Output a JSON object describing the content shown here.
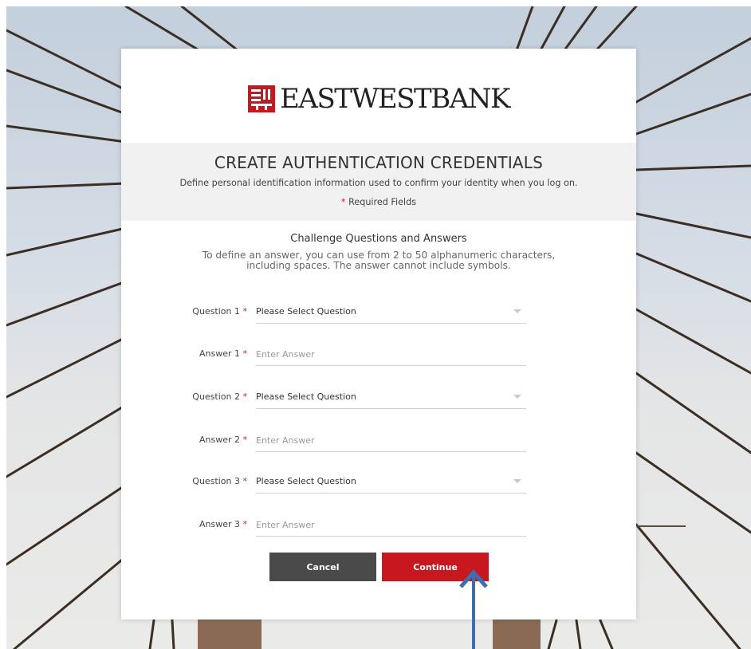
{
  "brand": {
    "name": "EASTWESTBANK",
    "accent": "#c8181f"
  },
  "header": {
    "title": "CREATE AUTHENTICATION CREDENTIALS",
    "subtitle": "Define personal identification information used to confirm your identity when you log on.",
    "required_star": "*",
    "required_text": "Required Fields"
  },
  "section": {
    "title": "Challenge Questions and Answers",
    "instructions": "To define an answer, you can use from 2 to 50 alphanumeric characters, including spaces. The answer cannot include symbols."
  },
  "fields": [
    {
      "label": "Question 1",
      "star": "*",
      "kind": "select",
      "value": "Please Select Question"
    },
    {
      "label": "Answer 1",
      "star": "*",
      "kind": "input",
      "placeholder": "Enter Answer"
    },
    {
      "label": "Question 2",
      "star": "*",
      "kind": "select",
      "value": "Please Select Question"
    },
    {
      "label": "Answer 2",
      "star": "*",
      "kind": "input",
      "placeholder": "Enter Answer"
    },
    {
      "label": "Question 3",
      "star": "*",
      "kind": "select",
      "value": "Please Select Question"
    },
    {
      "label": "Answer 3",
      "star": "*",
      "kind": "input",
      "placeholder": "Enter Answer"
    }
  ],
  "buttons": {
    "cancel": "Cancel",
    "continue": "Continue"
  },
  "colors": {
    "cancel_bg": "#4a4a4a",
    "continue_bg": "#c8181f",
    "arrow": "#3b6fb0",
    "required": "#c8202f"
  }
}
